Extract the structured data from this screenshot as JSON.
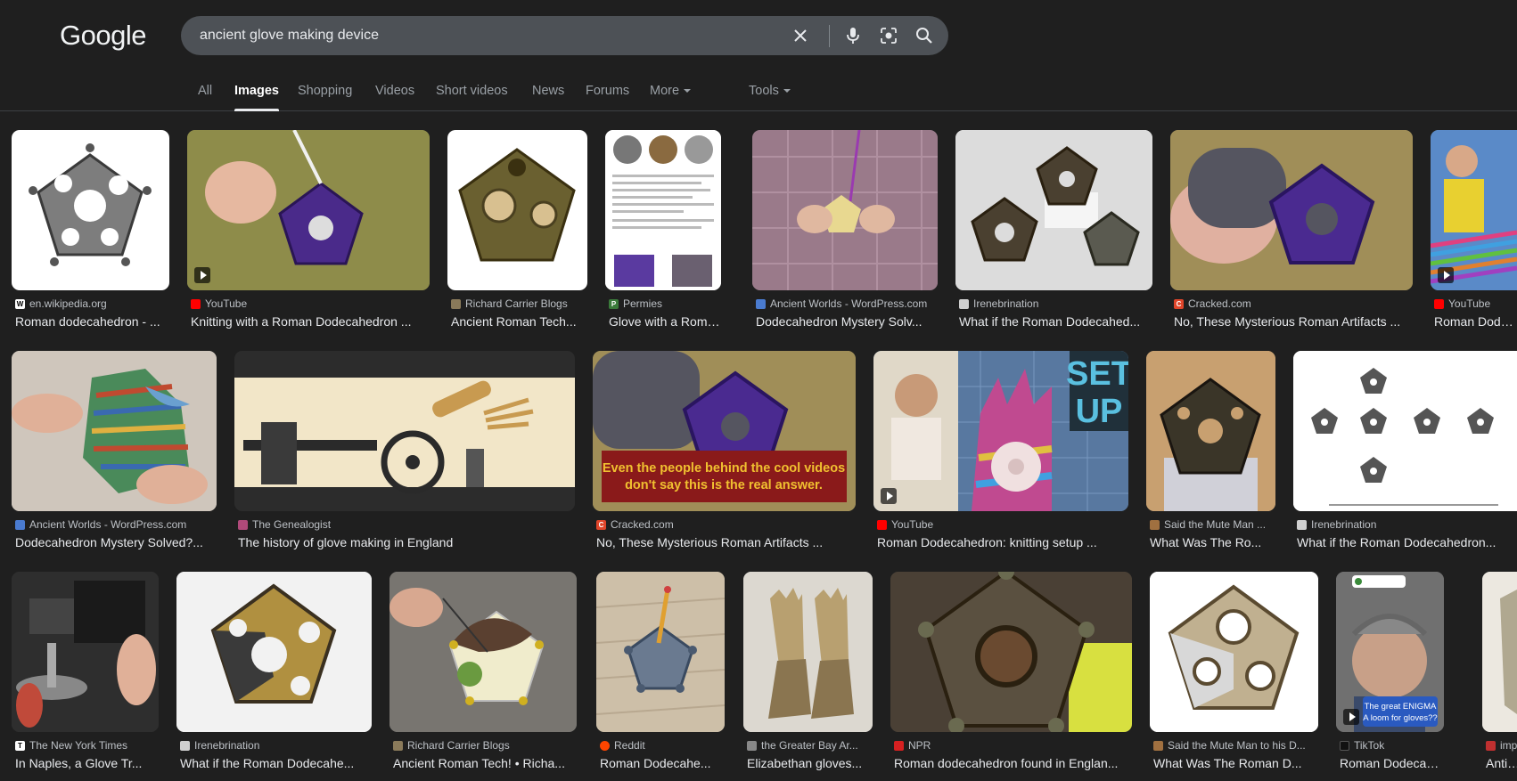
{
  "header": {
    "logo": "Google",
    "search_value": "ancient glove making device"
  },
  "icons": {
    "clear": "close-icon",
    "voice": "microphone-icon",
    "lens": "camera-lens-icon",
    "search": "search-icon"
  },
  "tabs": [
    {
      "label": "All"
    },
    {
      "label": "Images"
    },
    {
      "label": "Shopping"
    },
    {
      "label": "Videos"
    },
    {
      "label": "Short videos"
    },
    {
      "label": "News"
    },
    {
      "label": "Forums"
    },
    {
      "label": "More"
    }
  ],
  "tools_label": "Tools",
  "results": [
    {
      "source": "en.wikipedia.org",
      "title": "Roman dodecahedron - ...",
      "fav": "#ffffff",
      "fav_letter": "W"
    },
    {
      "source": "YouTube",
      "title": "Knitting with a Roman Dodecahedron ...",
      "fav": "#ff0000",
      "fav_letter": "",
      "video": true
    },
    {
      "source": "Richard Carrier Blogs",
      "title": "Ancient Roman Tech...",
      "fav": "#8a7a5a",
      "fav_letter": ""
    },
    {
      "source": "Permies",
      "title": "Glove with a Roma...",
      "fav": "#3a7a3a",
      "fav_letter": "P"
    },
    {
      "source": "Ancient Worlds - WordPress.com",
      "title": "Dodecahedron Mystery Solv...",
      "fav": "#4a7bd0",
      "fav_letter": ""
    },
    {
      "source": "Irenebrination",
      "title": "What if the Roman Dodecahed...",
      "fav": "#d0d0d0",
      "fav_letter": ""
    },
    {
      "source": "Cracked.com",
      "title": "No, These Mysterious Roman Artifacts ...",
      "fav": "#e0452a",
      "fav_letter": "C"
    },
    {
      "source": "YouTube",
      "title": "Roman Dodec...",
      "fav": "#ff0000",
      "fav_letter": "",
      "video": true
    },
    {
      "source": "Ancient Worlds - WordPress.com",
      "title": "Dodecahedron Mystery Solved?...",
      "fav": "#4a7bd0",
      "fav_letter": ""
    },
    {
      "source": "The Genealogist",
      "title": "The history of glove making in England",
      "fav": "#b04a7a",
      "fav_letter": ""
    },
    {
      "source": "Cracked.com",
      "title": "No, These Mysterious Roman Artifacts ...",
      "fav": "#e0452a",
      "fav_letter": "C"
    },
    {
      "source": "YouTube",
      "title": "Roman Dodecahedron: knitting setup ...",
      "fav": "#ff0000",
      "fav_letter": "",
      "video": true
    },
    {
      "source": "Said the Mute Man ...",
      "title": "What Was The Ro...",
      "fav": "#a07040",
      "fav_letter": ""
    },
    {
      "source": "Irenebrination",
      "title": "What if the Roman Dodecahedron...",
      "fav": "#d0d0d0",
      "fav_letter": ""
    },
    {
      "source": "The New York Times",
      "title": "In Naples, a Glove Tr...",
      "fav": "#ffffff",
      "fav_letter": "T"
    },
    {
      "source": "Irenebrination",
      "title": "What if the Roman Dodecahe...",
      "fav": "#d0d0d0",
      "fav_letter": ""
    },
    {
      "source": "Richard Carrier Blogs",
      "title": "Ancient Roman Tech! • Richa...",
      "fav": "#8a7a5a",
      "fav_letter": ""
    },
    {
      "source": "Reddit",
      "title": "Roman Dodecahe...",
      "fav": "#ff4500",
      "fav_letter": ""
    },
    {
      "source": "the Greater Bay Ar...",
      "title": "Elizabethan gloves...",
      "fav": "#888888",
      "fav_letter": ""
    },
    {
      "source": "NPR",
      "title": "Roman dodecahedron found in Englan...",
      "fav": "#d62021",
      "fav_letter": ""
    },
    {
      "source": "Said the Mute Man to his D...",
      "title": "What Was The Roman D...",
      "fav": "#a07040",
      "fav_letter": ""
    },
    {
      "source": "TikTok",
      "title": "Roman Dodecahe...",
      "fav": "#111111",
      "fav_letter": ""
    },
    {
      "source": "imp...",
      "title": "Antiq...",
      "fav": "#c03030",
      "fav_letter": ""
    }
  ],
  "overlays": {
    "cracked_caption_1": "Even the people behind the cool videos",
    "cracked_caption_2": "don't say this is the real answer.",
    "setup_text_1": "SET",
    "setup_text_2": "UP",
    "tiktok_text_1": "The great ENIGMA",
    "tiktok_text_2": "A loom for gloves??"
  }
}
